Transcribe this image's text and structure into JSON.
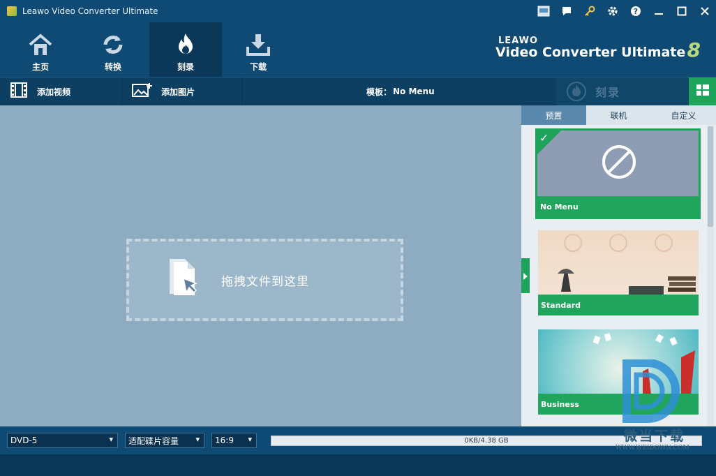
{
  "window": {
    "title": "Leawo Video Converter Ultimate"
  },
  "nav": {
    "tabs": [
      {
        "label": "主页",
        "icon": "home-icon"
      },
      {
        "label": "转换",
        "icon": "convert-icon"
      },
      {
        "label": "刻录",
        "icon": "burn-flame-icon",
        "active": true
      },
      {
        "label": "下载",
        "icon": "download-icon"
      }
    ],
    "brand_small": "LEAWO",
    "brand_big": "Video Converter Ultimate",
    "brand_version": "8"
  },
  "toolbar": {
    "add_video": "添加视频",
    "add_photo": "添加图片",
    "template_label": "模板：",
    "template_value": "No Menu",
    "burn": "刻录"
  },
  "main": {
    "drop_text": "拖拽文件到这里"
  },
  "panel": {
    "tabs": [
      {
        "label": "预置",
        "active": true
      },
      {
        "label": "联机"
      },
      {
        "label": "自定义"
      }
    ],
    "templates": [
      {
        "name": "No Menu",
        "selected": true
      },
      {
        "name": "Standard"
      },
      {
        "name": "Business"
      }
    ]
  },
  "bottom": {
    "disc_type": "DVD-5",
    "fit_mode": "适配碟片容量",
    "aspect": "16:9",
    "capacity_text": "0KB/4.38 GB",
    "capacity_fraction": 0
  },
  "watermark": {
    "text": "微当下载",
    "sub": "WWW.WEIDOWN.COM"
  },
  "colors": {
    "accent_green": "#1ea35a",
    "nav_bg": "#0e4a73",
    "main_bg": "#8dabc1"
  }
}
